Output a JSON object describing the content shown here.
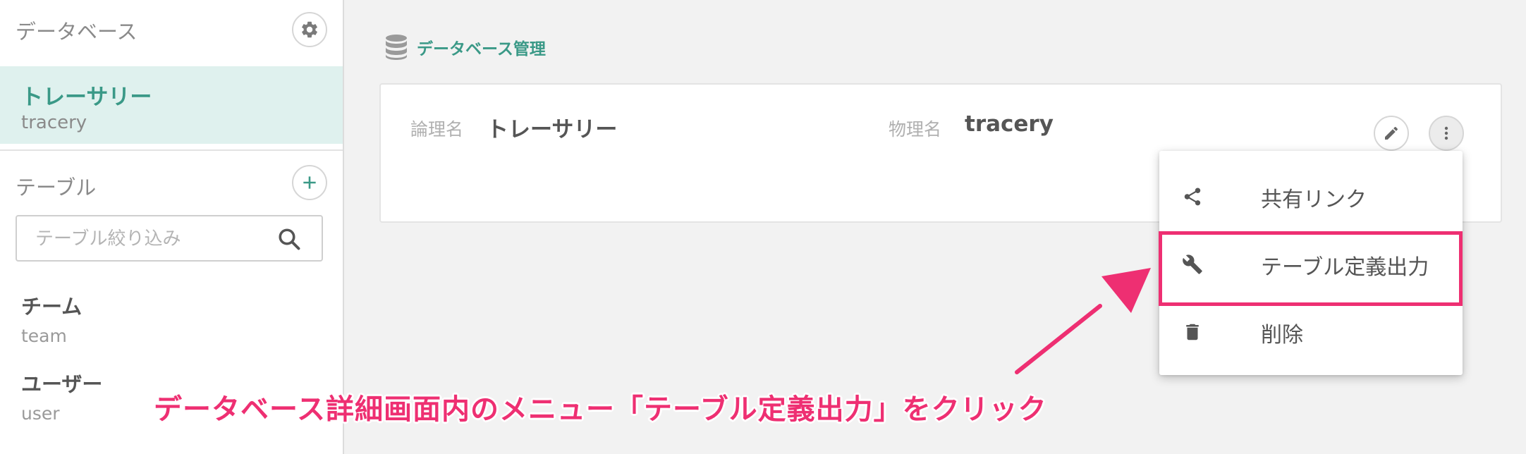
{
  "sidebar": {
    "header": "データベース",
    "selected_db": {
      "name": "トレーサリー",
      "sub": "tracery"
    },
    "tables_header": "テーブル",
    "search": {
      "placeholder": "テーブル絞り込み",
      "value": ""
    },
    "tables": [
      {
        "name": "チーム",
        "sub": "team"
      },
      {
        "name": "ユーザー",
        "sub": "user"
      }
    ]
  },
  "main": {
    "title": "データベース管理",
    "logical_label": "論理名",
    "logical_value": "トレーサリー",
    "physical_label": "物理名",
    "physical_value": "tracery"
  },
  "menu": {
    "items": [
      {
        "label": "共有リンク",
        "icon": "share-icon"
      },
      {
        "label": "テーブル定義出力",
        "icon": "wrench-icon"
      },
      {
        "label": "削除",
        "icon": "trash-icon"
      }
    ]
  },
  "annotation": {
    "text": "データベース詳細画面内のメニュー「テーブル定義出力」をクリック"
  },
  "colors": {
    "accent": "#3a9987",
    "selected_bg": "#dff1ee",
    "annotation": "#ee2f72"
  }
}
